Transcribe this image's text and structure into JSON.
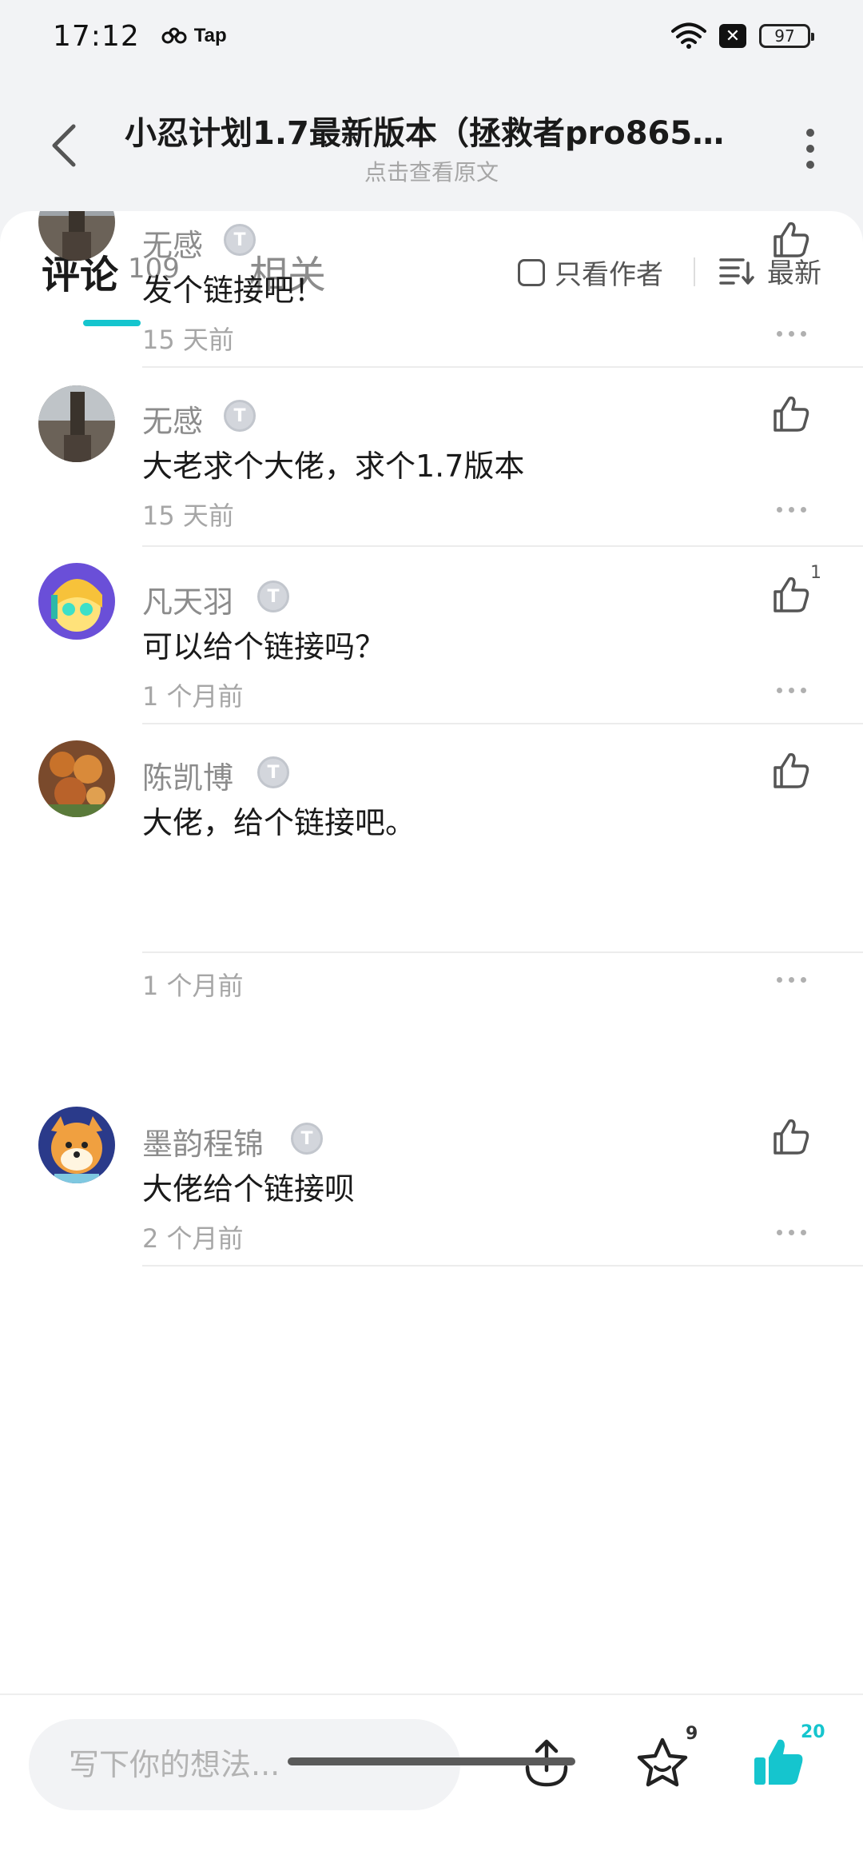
{
  "status_bar": {
    "time": "17:12",
    "tap_label": "Tap",
    "battery": "97",
    "close_glyph": "✕",
    "icons": [
      "wifi-icon",
      "close-badge-icon",
      "battery-icon"
    ]
  },
  "header": {
    "title": "小忍计划1.7最新版本（拯救者pro865p...",
    "subtitle": "点击查看原文",
    "back_icon": "chevron-left-icon",
    "more_icon": "more-vertical-icon"
  },
  "tabs": {
    "comments_label": "评论",
    "comments_count": "109",
    "related_label": "相关",
    "author_only_label": "只看作者",
    "sort_label": "最新"
  },
  "comments": [
    {
      "username": "无感",
      "text": "发个链接吧！",
      "time": "15 天前",
      "likes": ""
    },
    {
      "username": "无感",
      "text": "大老求个大佬，求个1.7版本",
      "time": "15 天前",
      "likes": ""
    },
    {
      "username": "凡天羽",
      "text": "可以给个链接吗？",
      "time": "1 个月前",
      "likes": "1"
    },
    {
      "username": "陈凯博",
      "text": "大佬，给个链接吧。",
      "time": "1 个月前",
      "likes": ""
    },
    {
      "username": "墨韵程锦",
      "text": "大佬给个链接呗",
      "time": "2 个月前",
      "likes": ""
    }
  ],
  "user_badge_letter": "T",
  "bottom_bar": {
    "compose_placeholder": "写下你的想法...",
    "favorite_count": "9",
    "like_count": "20"
  },
  "colors": {
    "accent": "#15c5ce",
    "background": "#f2f3f5",
    "text_secondary": "#8c8c8c"
  }
}
